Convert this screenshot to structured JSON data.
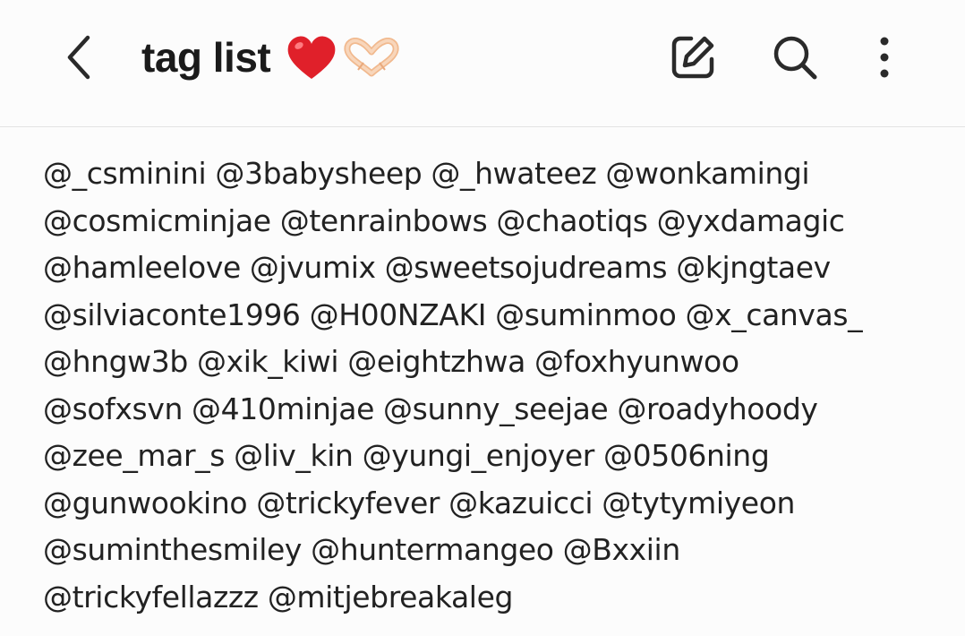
{
  "header": {
    "title": "tag list",
    "title_emoji_1": "red-heart-emoji",
    "title_emoji_2": "heart-hands-emoji",
    "back_icon": "chevron-left-icon",
    "edit_icon": "edit-note-icon",
    "search_icon": "search-icon",
    "more_icon": "more-vertical-icon"
  },
  "note": {
    "lines": [
      "@_csminini @3babysheep @_hwateez @wonkamingi",
      "@cosmicminjae @tenrainbows @chaotiqs @yxdamagic",
      "@hamleelove @jvumix @sweetsojudreams @kjngtaev",
      "@silviaconte1996 @H00NZAKI @suminmoo @x_canvas_",
      "@hngw3b @xik_kiwi @eightzhwa @foxhyunwoo",
      "@sofxsvn @410minjae @sunny_seejae @roadyhoody",
      "@zee_mar_s @liv_kin @yungi_enjoyer @0506ning",
      "@gunwookino @trickyfever @kazuicci @tytymiyeon",
      "@suminthesmiley @huntermangeo @Bxxiin",
      "@trickyfellazzz @mitjebreakaleg"
    ]
  },
  "colors": {
    "background": "#fcfcfc",
    "text": "#222222",
    "heart": "#e0202a",
    "hands": "#f6c9a4"
  }
}
